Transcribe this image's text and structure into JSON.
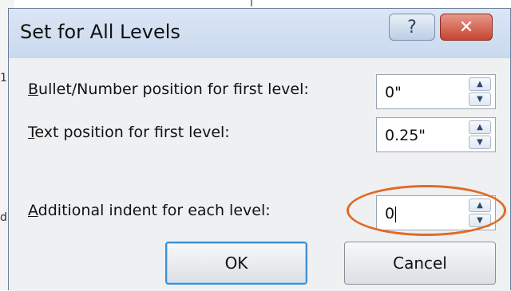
{
  "dialog": {
    "title": "Set for All Levels",
    "help_glyph": "?",
    "close_glyph": "✕"
  },
  "fields": [
    {
      "label_underlined": "B",
      "label_rest": "ullet/Number position for first level:",
      "value": "0\""
    },
    {
      "label_underlined": "T",
      "label_rest": "ext position for first level:",
      "value": "0.25\""
    },
    {
      "label_underlined": "A",
      "label_rest": "dditional indent for each level:",
      "value": "0"
    }
  ],
  "buttons": {
    "ok_label": "OK",
    "cancel_label": "Cancel"
  },
  "background_fragments": {
    "frag1": "1",
    "frag2": "d"
  },
  "annotation": {
    "highlight_color": "#e26a26"
  }
}
